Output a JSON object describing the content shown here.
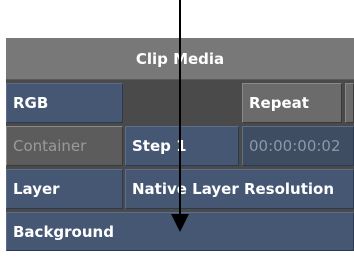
{
  "panel": {
    "title": "Clip Media",
    "color_mode": "RGB",
    "repeat_label": "Repeat",
    "container_label": "Container",
    "step_label": "Step 1",
    "timecode": "00:00:00:02",
    "layer_label": "Layer",
    "layer_resolution": "Native Layer Resolution",
    "background_label": "Background"
  },
  "colors": {
    "title_bar": "#787878",
    "button_gray": "#6b6b6b",
    "field_blue": "#455773",
    "panel_bg": "#4a4a4a"
  },
  "icons": {
    "arrow": "down-arrow-icon"
  }
}
